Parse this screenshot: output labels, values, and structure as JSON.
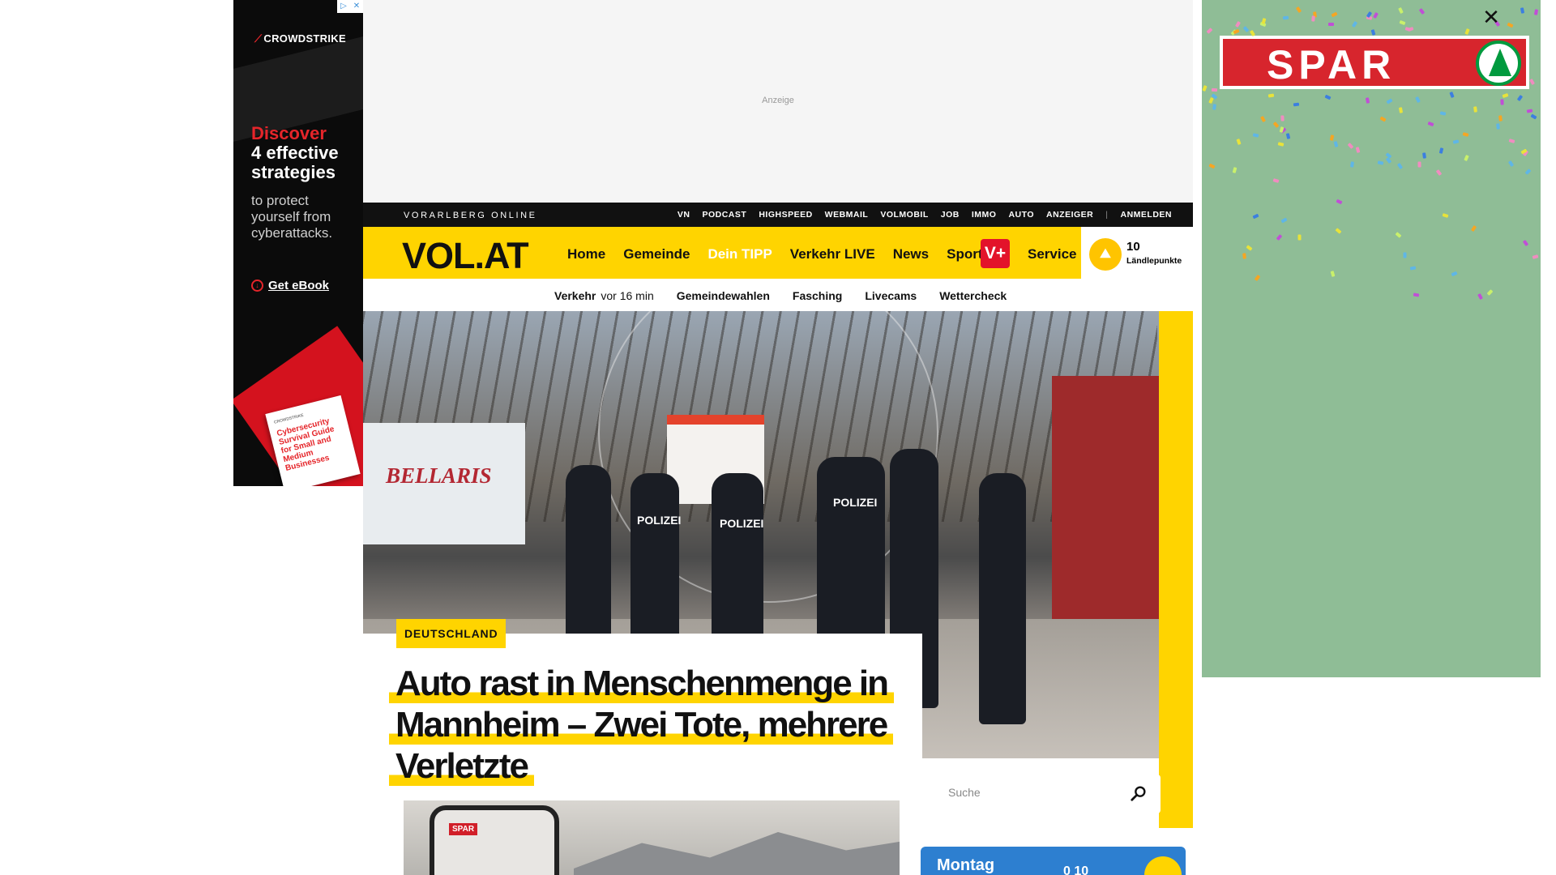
{
  "left_ad": {
    "adchoices": [
      "▷",
      "✕"
    ],
    "brand": "CROWDSTRIKE",
    "headline_red": "Discover",
    "headline_white": "4 effective strategies",
    "body": "to protect yourself from cyberattacks.",
    "cta": "Get eBook",
    "book_small": "CROWDSTRIKE",
    "book_title": "Cybersecurity Survival Guide for Small and Medium Businesses",
    "colors": {
      "bg": "#0b0b0b",
      "accent": "#e5252a"
    }
  },
  "banner": {
    "label": "Anzeige"
  },
  "topbar": {
    "brand": "VORARLBERG ONLINE",
    "links": [
      "VN",
      "PODCAST",
      "HIGHSPEED",
      "WEBMAIL",
      "VOLMOBIL",
      "JOB",
      "IMMO",
      "AUTO",
      "ANZEIGER"
    ],
    "separator": "|",
    "login": "ANMELDEN"
  },
  "nav": {
    "logo": "VOL.AT",
    "items": [
      "Home",
      "Gemeinde",
      "Dein TIPP",
      "Verkehr LIVE",
      "News",
      "Sport"
    ],
    "vplus": "V+",
    "service": "Service",
    "points_value": "10",
    "points_label": "Ländlepunkte",
    "colors": {
      "brand_yellow": "#ffd400",
      "vplus_red": "#e3132a"
    }
  },
  "subnav": {
    "verkehr_label": "Verkehr",
    "verkehr_time": "vor 16 min",
    "items": [
      "Gemeindewahlen",
      "Fasching",
      "Livecams",
      "Wettercheck"
    ]
  },
  "hero": {
    "truck_text": "BELLARIS",
    "police_labels": [
      "POLIZEI",
      "POLIZEI",
      "POLIZEI"
    ]
  },
  "article": {
    "category": "DEUTSCHLAND",
    "headline": "Auto rast in Menschenmenge in Mannheim – Zwei Tote, mehrere Verletzte",
    "thumb_badge": "SPAR"
  },
  "search": {
    "placeholder": "Suche"
  },
  "weather": {
    "day": "Montag",
    "temp": "0 10"
  },
  "right_ad": {
    "brand": "SPAR",
    "colors": {
      "bg": "#8fbd96",
      "red": "#d7252d",
      "green": "#009a3e"
    }
  },
  "close_label": "✕"
}
